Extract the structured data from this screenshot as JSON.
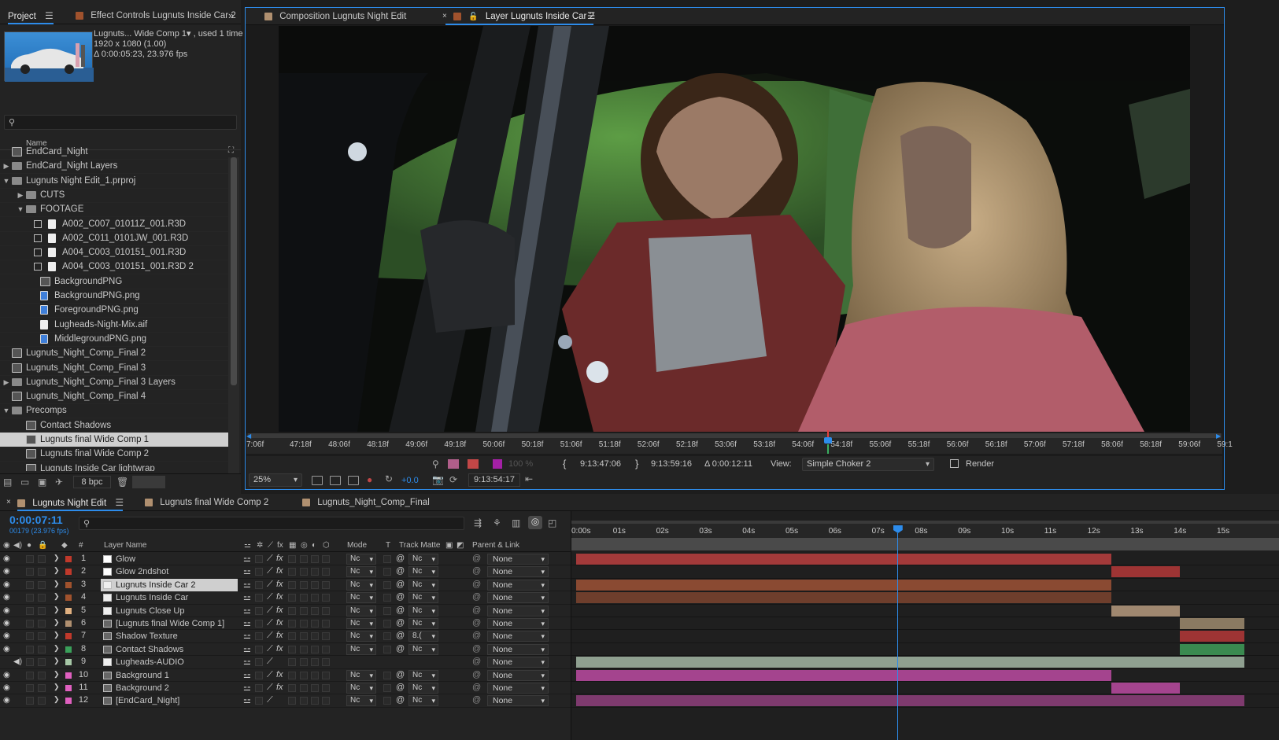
{
  "project": {
    "tab_label": "Project",
    "effect_controls_tab": "Effect Controls Lugnuts Inside Car 2",
    "info_name": "Lugnuts... Wide Comp 1▾ , used 1 time",
    "info_size": "1920 x 1080 (1.00)",
    "info_duration": "Δ 0:00:05:23, 23.976 fps",
    "search_placeholder": "",
    "col_name": "Name",
    "items": [
      {
        "label": "EndCard_Night",
        "type": "comp",
        "indent": 0,
        "twirl": ""
      },
      {
        "label": "EndCard_Night Layers",
        "type": "folder",
        "indent": 0,
        "twirl": "▶"
      },
      {
        "label": "Lugnuts Night Edit_1.prproj",
        "type": "folder",
        "indent": 0,
        "twirl": "▼"
      },
      {
        "label": "CUTS",
        "type": "folder",
        "indent": 1,
        "twirl": "▶"
      },
      {
        "label": "FOOTAGE",
        "type": "folder",
        "indent": 1,
        "twirl": "▼"
      },
      {
        "label": "A002_C007_01011Z_001.R3D",
        "type": "file",
        "indent": 2,
        "twirl": "",
        "check": true
      },
      {
        "label": "A002_C011_0101JW_001.R3D",
        "type": "file",
        "indent": 2,
        "twirl": "",
        "check": true
      },
      {
        "label": "A004_C003_010151_001.R3D",
        "type": "file",
        "indent": 2,
        "twirl": "",
        "check": true
      },
      {
        "label": "A004_C003_010151_001.R3D 2",
        "type": "file",
        "indent": 2,
        "twirl": "",
        "check": true
      },
      {
        "label": "BackgroundPNG",
        "type": "comp",
        "indent": 2,
        "twirl": ""
      },
      {
        "label": "BackgroundPNG.png",
        "type": "img",
        "indent": 2,
        "twirl": ""
      },
      {
        "label": "ForegroundPNG.png",
        "type": "img",
        "indent": 2,
        "twirl": ""
      },
      {
        "label": "Lugheads-Night-Mix.aif",
        "type": "file",
        "indent": 2,
        "twirl": ""
      },
      {
        "label": "MiddlegroundPNG.png",
        "type": "img",
        "indent": 2,
        "twirl": ""
      },
      {
        "label": "Lugnuts_Night_Comp_Final 2",
        "type": "comp",
        "indent": 0,
        "twirl": ""
      },
      {
        "label": "Lugnuts_Night_Comp_Final 3",
        "type": "comp",
        "indent": 0,
        "twirl": ""
      },
      {
        "label": "Lugnuts_Night_Comp_Final 3 Layers",
        "type": "folder",
        "indent": 0,
        "twirl": "▶"
      },
      {
        "label": "Lugnuts_Night_Comp_Final 4",
        "type": "comp",
        "indent": 0,
        "twirl": ""
      },
      {
        "label": "Precomps",
        "type": "folder",
        "indent": 0,
        "twirl": "▼"
      },
      {
        "label": "Contact Shadows",
        "type": "comp",
        "indent": 1,
        "twirl": ""
      },
      {
        "label": "Lugnuts final Wide Comp 1",
        "type": "comp",
        "indent": 1,
        "twirl": "",
        "selected": true
      },
      {
        "label": "Lugnuts final Wide Comp 2",
        "type": "comp",
        "indent": 1,
        "twirl": ""
      },
      {
        "label": "Lugnuts Inside Car lightwrap",
        "type": "comp",
        "indent": 1,
        "twirl": ""
      }
    ],
    "bpc": "8 bpc"
  },
  "viewer": {
    "comp_tab": "Composition Lugnuts Night Edit",
    "layer_tab": "Layer Lugnuts Inside Car 2",
    "ruler_ticks": [
      "7:06f",
      "47:18f",
      "48:06f",
      "48:18f",
      "49:06f",
      "49:18f",
      "50:06f",
      "50:18f",
      "51:06f",
      "51:18f",
      "52:06f",
      "52:18f",
      "53:06f",
      "53:18f",
      "54:06f",
      "54:18f",
      "55:06f",
      "55:18f",
      "56:06f",
      "56:18f",
      "57:06f",
      "57:18f",
      "58:06f",
      "58:18f",
      "59:06f",
      "59:1"
    ],
    "opacity": "100 %",
    "in_point": "9:13:47:06",
    "out_point": "9:13:59:16",
    "duration": "Δ 0:00:12:11",
    "view_label": "View:",
    "view_value": "Simple Choker 2",
    "render_label": "Render",
    "zoom": "25%",
    "exposure": "+0.0",
    "current_time": "9:13:54:17"
  },
  "timeline": {
    "tabs": [
      "Lugnuts Night Edit",
      "Lugnuts final Wide Comp 2",
      "Lugnuts_Night_Comp_Final"
    ],
    "timecode": "0:00:07:11",
    "frames": "00179 (23.976 fps)",
    "search_placeholder": "",
    "col_layer_name": "Layer Name",
    "col_mode": "Mode",
    "col_t": "T",
    "col_track_matte": "Track Matte",
    "col_parent": "Parent & Link",
    "col_hash": "#",
    "ruler": [
      "0:00s",
      "01s",
      "02s",
      "03s",
      "04s",
      "05s",
      "06s",
      "07s",
      "08s",
      "09s",
      "10s",
      "11s",
      "12s",
      "13s",
      "14s",
      "15s"
    ],
    "playhead_seconds": 7.46,
    "layers": [
      {
        "n": "1",
        "name": "Glow",
        "color": "#c0392b",
        "mode": "Nc",
        "tm": "Nc",
        "parent": "None",
        "icon": "solid-white",
        "fx": true
      },
      {
        "n": "2",
        "name": "Glow 2ndshot",
        "color": "#c0392b",
        "mode": "Nc",
        "tm": "Nc",
        "parent": "None",
        "icon": "solid-white",
        "fx": true
      },
      {
        "n": "3",
        "name": "Lugnuts Inside Car 2",
        "color": "#a0522d",
        "mode": "Nc",
        "tm": "Nc",
        "parent": "None",
        "icon": "file",
        "fx": true,
        "selected": true
      },
      {
        "n": "4",
        "name": "Lugnuts Inside Car",
        "color": "#a0522d",
        "mode": "Nc",
        "tm": "Nc",
        "parent": "None",
        "icon": "file",
        "fx": true
      },
      {
        "n": "5",
        "name": "Lugnuts Close Up",
        "color": "#e0b080",
        "mode": "Nc",
        "tm": "Nc",
        "parent": "None",
        "icon": "file",
        "fx": true
      },
      {
        "n": "6",
        "name": "[Lugnuts final Wide Comp 1]",
        "color": "#b09070",
        "mode": "Nc",
        "tm": "Nc",
        "parent": "None",
        "icon": "comp",
        "fx": true
      },
      {
        "n": "7",
        "name": "Shadow Texture",
        "color": "#c0392b",
        "mode": "Nc",
        "tm": "8.(",
        "parent": "None",
        "icon": "comp",
        "fx": true
      },
      {
        "n": "8",
        "name": "Contact Shadows",
        "color": "#3aa05a",
        "mode": "Nc",
        "tm": "Nc",
        "parent": "None",
        "icon": "comp",
        "fx": true
      },
      {
        "n": "9",
        "name": "Lugheads-AUDIO",
        "color": "#a6c7a6",
        "mode": "",
        "tm": "",
        "parent": "None",
        "icon": "file",
        "fx": false,
        "audio": true
      },
      {
        "n": "10",
        "name": "Background 1",
        "color": "#e060c0",
        "mode": "Nc",
        "tm": "Nc",
        "parent": "None",
        "icon": "comp",
        "fx": true
      },
      {
        "n": "11",
        "name": "Background 2",
        "color": "#e060c0",
        "mode": "Nc",
        "tm": "Nc",
        "parent": "None",
        "icon": "comp",
        "fx": true
      },
      {
        "n": "12",
        "name": "[EndCard_Night]",
        "color": "#e060c0",
        "mode": "Nc",
        "tm": "Nc",
        "parent": "None",
        "icon": "comp",
        "fx": false
      }
    ],
    "bars": [
      [
        {
          "start": 0,
          "end": 12.4,
          "color": "#a33a3a"
        }
      ],
      [
        {
          "start": 12.4,
          "end": 14,
          "color": "#9e3434"
        }
      ],
      [
        {
          "start": 0,
          "end": 12.4,
          "color": "#8a4a32"
        }
      ],
      [
        {
          "start": 0,
          "end": 12.4,
          "color": "#6e3e2c"
        }
      ],
      [
        {
          "start": 12.4,
          "end": 14,
          "color": "#a08870"
        }
      ],
      [
        {
          "start": 14,
          "end": 15.5,
          "color": "#8a7a62"
        }
      ],
      [
        {
          "start": 14,
          "end": 15.5,
          "color": "#9e3434"
        }
      ],
      [
        {
          "start": 14,
          "end": 15.5,
          "color": "#3a8a50"
        }
      ],
      [
        {
          "start": 0,
          "end": 15.5,
          "color": "#8fa090"
        }
      ],
      [
        {
          "start": 0,
          "end": 12.4,
          "color": "#a4448e"
        }
      ],
      [
        {
          "start": 12.4,
          "end": 14,
          "color": "#a4448e"
        }
      ],
      [
        {
          "start": 0,
          "end": 15.5,
          "color": "#7e3a6e"
        }
      ]
    ]
  }
}
